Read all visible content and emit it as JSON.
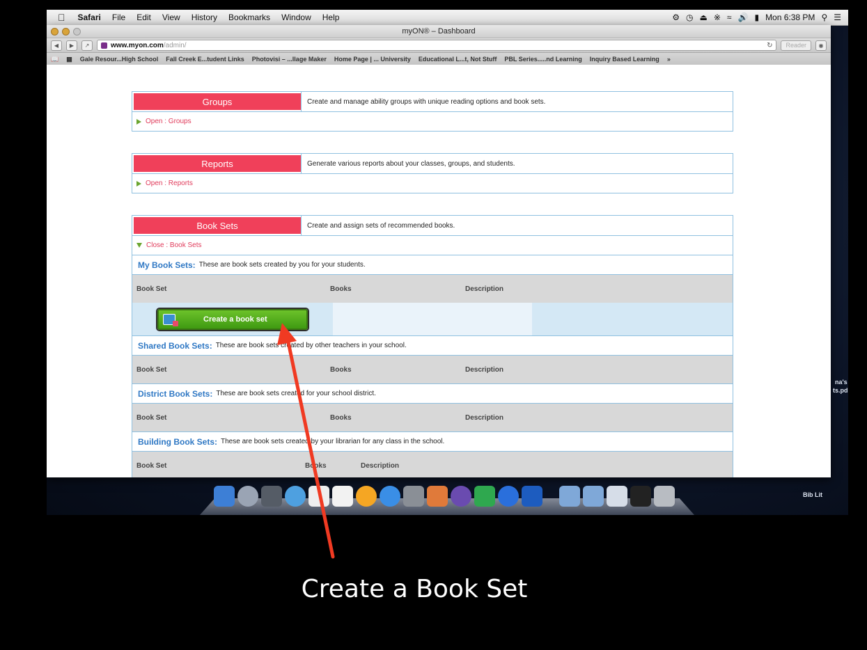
{
  "menubar": {
    "apple": "",
    "app": "Safari",
    "items": [
      "File",
      "Edit",
      "View",
      "History",
      "Bookmarks",
      "Window",
      "Help"
    ],
    "clock": "Mon 6:38 PM"
  },
  "window": {
    "title": "myON® – Dashboard",
    "url_host": "www.myon.com",
    "url_path": "/admin/",
    "reader": "Reader",
    "bookmarks": [
      "Gale Resour...High School",
      "Fall Creek E...tudent Links",
      "Photovisi – ...llage Maker",
      "Home Page | ... University",
      "Educational L...t, Not Stuff",
      "PBL Series.....nd Learning",
      "Inquiry Based Learning",
      "»"
    ]
  },
  "panels": {
    "groups": {
      "tab": "Groups",
      "desc": "Create and manage ability groups with unique reading options and book sets.",
      "link": "Open : Groups"
    },
    "reports": {
      "tab": "Reports",
      "desc": "Generate various reports about your classes, groups, and students.",
      "link": "Open : Reports"
    },
    "booksets": {
      "tab": "Book Sets",
      "desc": "Create and assign sets of recommended books.",
      "link": "Close : Book Sets"
    }
  },
  "sections": {
    "my": {
      "title": "My Book Sets:",
      "desc": "These are book sets created by you for your students."
    },
    "shared": {
      "title": "Shared Book Sets:",
      "desc": "These are book sets created by other teachers in your school."
    },
    "district": {
      "title": "District Book Sets:",
      "desc": "These are book sets created for your school district."
    },
    "building": {
      "title": "Building Book Sets:",
      "desc": "These are book sets created by your librarian for any class in the school."
    }
  },
  "columns": {
    "bookset": "Book Set",
    "books": "Books",
    "description": "Description"
  },
  "create_button": "Create a book set",
  "desktop": {
    "label1": "na's",
    "label2": "ts.pd",
    "label3": "Bib Lit"
  },
  "caption": "Create a Book Set",
  "colors": {
    "tab": "#f0405a",
    "accent_blue": "#2f78c4",
    "green": "#4fae18",
    "arrow": "#f03a22"
  }
}
